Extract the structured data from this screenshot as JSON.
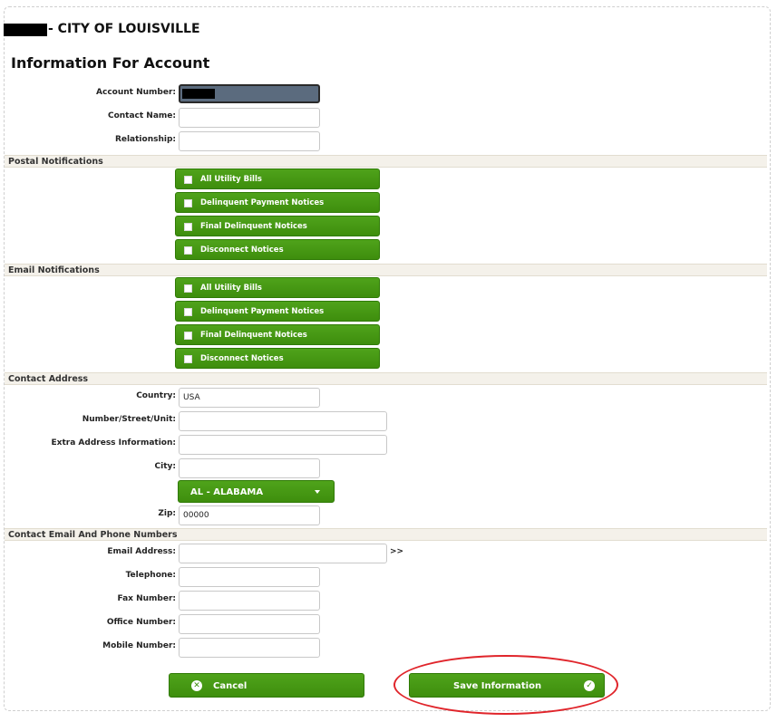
{
  "header": {
    "site_title": "- CITY OF LOUISVILLE",
    "page_title": "Information For Account"
  },
  "account": {
    "account_number_label": "Account Number:",
    "contact_name_label": "Contact Name:",
    "relationship_label": "Relationship:",
    "account_number_value": "",
    "contact_name_value": "",
    "relationship_value": ""
  },
  "postal": {
    "heading": "Postal Notifications",
    "options": [
      "All Utility Bills",
      "Delinquent Payment Notices",
      "Final Delinquent Notices",
      "Disconnect Notices"
    ]
  },
  "email": {
    "heading": "Email Notifications",
    "options": [
      "All Utility Bills",
      "Delinquent Payment Notices",
      "Final Delinquent Notices",
      "Disconnect Notices"
    ]
  },
  "address": {
    "heading": "Contact Address",
    "country_label": "Country:",
    "country_value": "USA",
    "street_label": "Number/Street/Unit:",
    "extra_label": "Extra Address Information:",
    "city_label": "City:",
    "state_value": "AL - ALABAMA",
    "zip_label": "Zip:",
    "zip_value": "00000"
  },
  "contact": {
    "heading": "Contact Email And Phone Numbers",
    "email_label": "Email Address:",
    "email_arrow": ">>",
    "telephone_label": "Telephone:",
    "fax_label": "Fax Number:",
    "office_label": "Office Number:",
    "mobile_label": "Mobile Number:"
  },
  "actions": {
    "cancel_label": "Cancel",
    "save_label": "Save Information"
  },
  "colors": {
    "button_green": "#3e8e0d",
    "section_bg": "#f4f1ea",
    "highlight_red": "#e0252b"
  }
}
